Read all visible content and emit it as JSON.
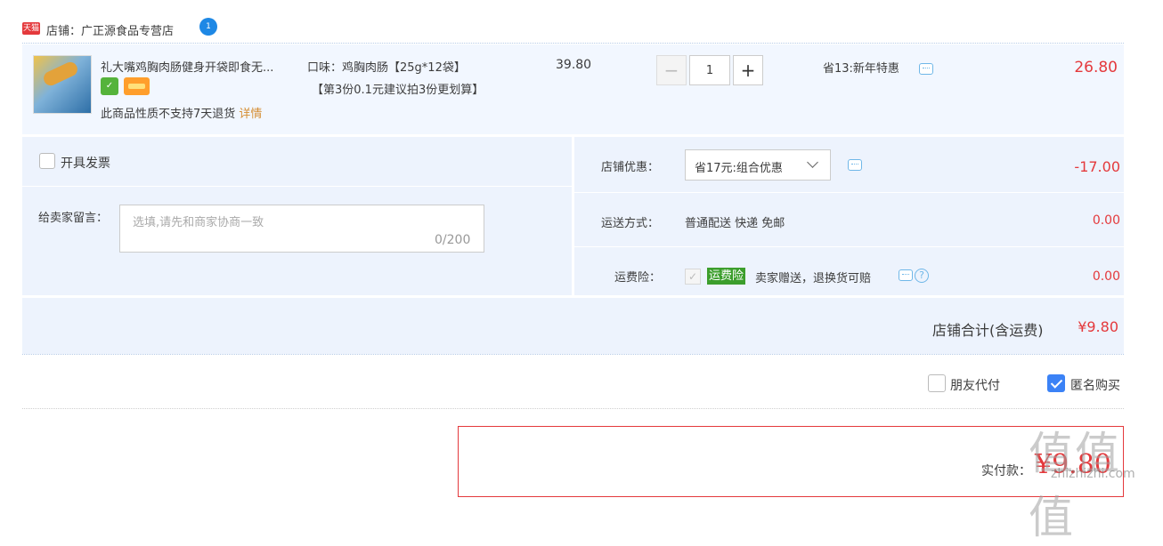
{
  "shop": {
    "badge": "天猫",
    "name": "店铺：广正源食品专营店"
  },
  "item": {
    "title": "礼大嘴鸡胸肉肠健身开袋即食无...",
    "sku": "口味：鸡胸肉肠【25g*12袋】",
    "sku_promo": "【第3份0.1元建议拍3份更划算】",
    "unit_price": "39.80",
    "quantity": "1",
    "minus": "−",
    "plus": "+",
    "discount": "省13:新年特惠",
    "total": "26.80",
    "no_return_text": "此商品性质不支持7天退货",
    "detail_link": "详情"
  },
  "invoice": {
    "label": "开具发票"
  },
  "memo": {
    "label": "给卖家留言：",
    "placeholder": "选填,请先和商家协商一致",
    "count": "0/200"
  },
  "shop_discount": {
    "label": "店铺优惠：",
    "selected": "省17元:组合优惠",
    "value": "-17.00"
  },
  "shipping": {
    "label": "运送方式：",
    "method": "普通配送 快递 免邮",
    "value": "0.00"
  },
  "insurance": {
    "label": "运费险：",
    "tag": "运费险",
    "desc": "卖家赠送，退换货可赔",
    "value": "0.00"
  },
  "summary": {
    "label": "店铺合计(含运费)",
    "value": "¥9.80"
  },
  "options": {
    "friend_pay": "朋友代付",
    "anonymous": "匿名购买"
  },
  "payment": {
    "label": "实付款：",
    "value": "¥9.80"
  },
  "watermark": {
    "logo": "值值值",
    "text": "zhizhizhi.com"
  },
  "colors": {
    "accent_red": "#e4393c",
    "row_bg": "#f2f7ff",
    "panel_bg": "#edf3fd",
    "checkbox_blue": "#3b82f6"
  }
}
